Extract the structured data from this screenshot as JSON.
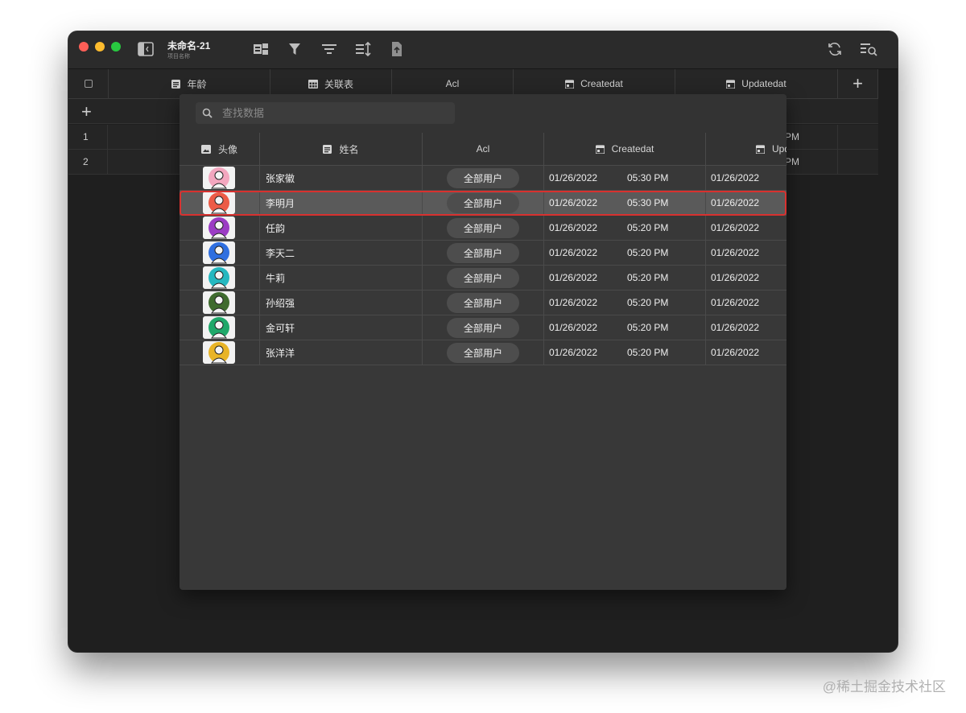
{
  "window": {
    "title": "未命名-21",
    "subtitle": "项目名称",
    "traffic_lights": [
      "#fe5f57",
      "#febc2e",
      "#28c840"
    ]
  },
  "toolbar": {
    "icons": [
      "sidebar-toggle-icon",
      "fields-icon",
      "filter-icon",
      "group-icon",
      "sort-icon",
      "share-icon",
      "refresh-icon",
      "search-list-icon"
    ]
  },
  "background_grid": {
    "headers": [
      "年龄",
      "关联表",
      "Acl",
      "Createdat",
      "Updatedat"
    ],
    "add_column_label": "+",
    "add_row_label": "+",
    "rows": [
      {
        "num": "1",
        "tail": "PM"
      },
      {
        "num": "2",
        "tail": "PM"
      }
    ]
  },
  "popover": {
    "search": {
      "placeholder": "查找数据",
      "value": ""
    },
    "columns": [
      "头像",
      "姓名",
      "Acl",
      "Createdat",
      "Upd"
    ],
    "rows": [
      {
        "name": "张家徽",
        "acl": "全部用户",
        "created_date": "01/26/2022",
        "created_time": "05:30 PM",
        "updated_date": "01/26/2022",
        "avatar_color": "#f3a7bf"
      },
      {
        "name": "李明月",
        "acl": "全部用户",
        "created_date": "01/26/2022",
        "created_time": "05:30 PM",
        "updated_date": "01/26/2022",
        "avatar_color": "#ec5b46"
      },
      {
        "name": "任韵",
        "acl": "全部用户",
        "created_date": "01/26/2022",
        "created_time": "05:20 PM",
        "updated_date": "01/26/2022",
        "avatar_color": "#9b3cc4"
      },
      {
        "name": "李天二",
        "acl": "全部用户",
        "created_date": "01/26/2022",
        "created_time": "05:20 PM",
        "updated_date": "01/26/2022",
        "avatar_color": "#2f6fe0"
      },
      {
        "name": "牛莉",
        "acl": "全部用户",
        "created_date": "01/26/2022",
        "created_time": "05:20 PM",
        "updated_date": "01/26/2022",
        "avatar_color": "#25b8c0"
      },
      {
        "name": "孙绍强",
        "acl": "全部用户",
        "created_date": "01/26/2022",
        "created_time": "05:20 PM",
        "updated_date": "01/26/2022",
        "avatar_color": "#3f6b2e"
      },
      {
        "name": "金可轩",
        "acl": "全部用户",
        "created_date": "01/26/2022",
        "created_time": "05:20 PM",
        "updated_date": "01/26/2022",
        "avatar_color": "#1fa86a"
      },
      {
        "name": "张洋洋",
        "acl": "全部用户",
        "created_date": "01/26/2022",
        "created_time": "05:20 PM",
        "updated_date": "01/26/2022",
        "avatar_color": "#e8b427"
      }
    ],
    "highlighted_row_index": 1,
    "highlight_color": "#d8312f"
  },
  "watermark": "@稀土掘金技术社区"
}
